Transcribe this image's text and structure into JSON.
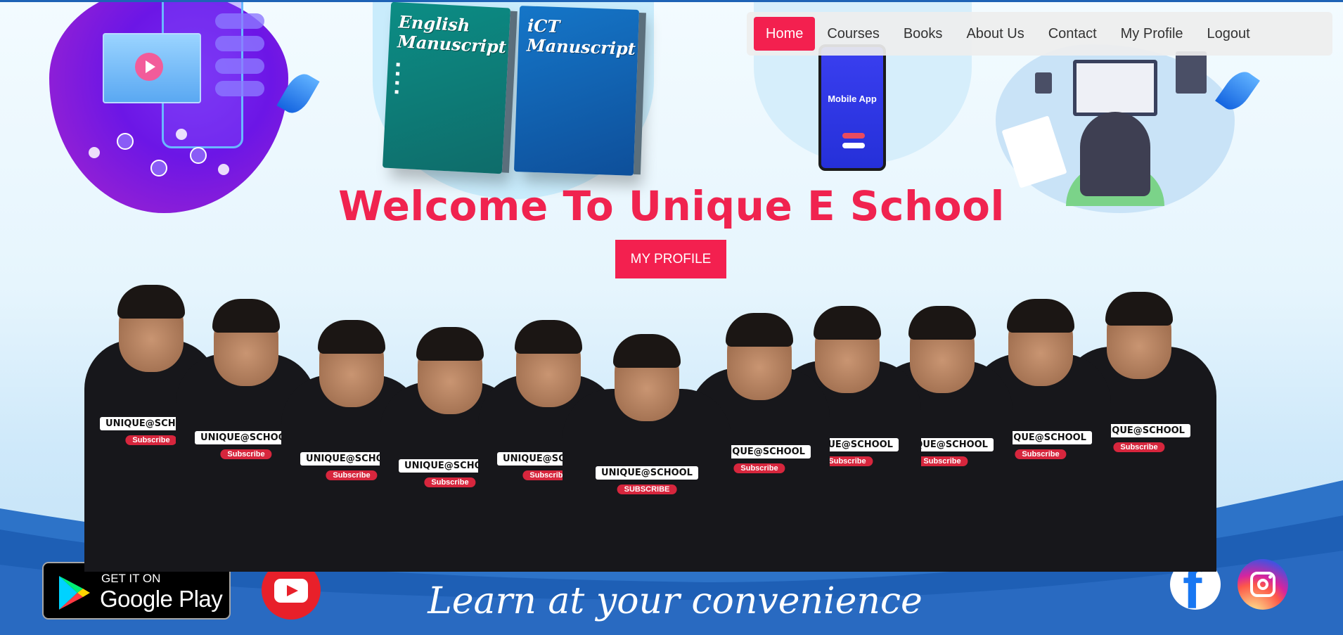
{
  "nav": {
    "items": [
      {
        "label": "Home",
        "active": true
      },
      {
        "label": "Courses",
        "active": false
      },
      {
        "label": "Books",
        "active": false
      },
      {
        "label": "About Us",
        "active": false
      },
      {
        "label": "Contact",
        "active": false
      },
      {
        "label": "My Profile",
        "active": false
      },
      {
        "label": "Logout",
        "active": false
      }
    ]
  },
  "hero": {
    "title": "Welcome To Unique E School",
    "cta_label": "MY PROFILE",
    "tagline": "Learn at your convenience"
  },
  "books": {
    "english": {
      "title_line1": "English",
      "title_line2": "Manuscript"
    },
    "ict": {
      "title_line1": "iCT",
      "title_line2": "Manuscript"
    }
  },
  "mobile_app": {
    "label": "Mobile App"
  },
  "team_shirt": {
    "logo": "UNIQUE@SCHOOL",
    "sub": "SUBSCRIBE",
    "sub_alt": "Subscribe"
  },
  "store": {
    "get_it_on": "GET IT ON",
    "store_name": "Google Play"
  },
  "social": {
    "facebook_letter": "f"
  },
  "colors": {
    "accent": "#f3204f",
    "nav_bg": "#eeeeee",
    "wave_blue": "#1e63b6",
    "youtube_red": "#e8202a",
    "facebook_blue": "#1877f2"
  },
  "icons": {
    "store": "google-play-icon",
    "youtube": "youtube-icon",
    "facebook": "facebook-icon",
    "instagram": "instagram-icon"
  }
}
